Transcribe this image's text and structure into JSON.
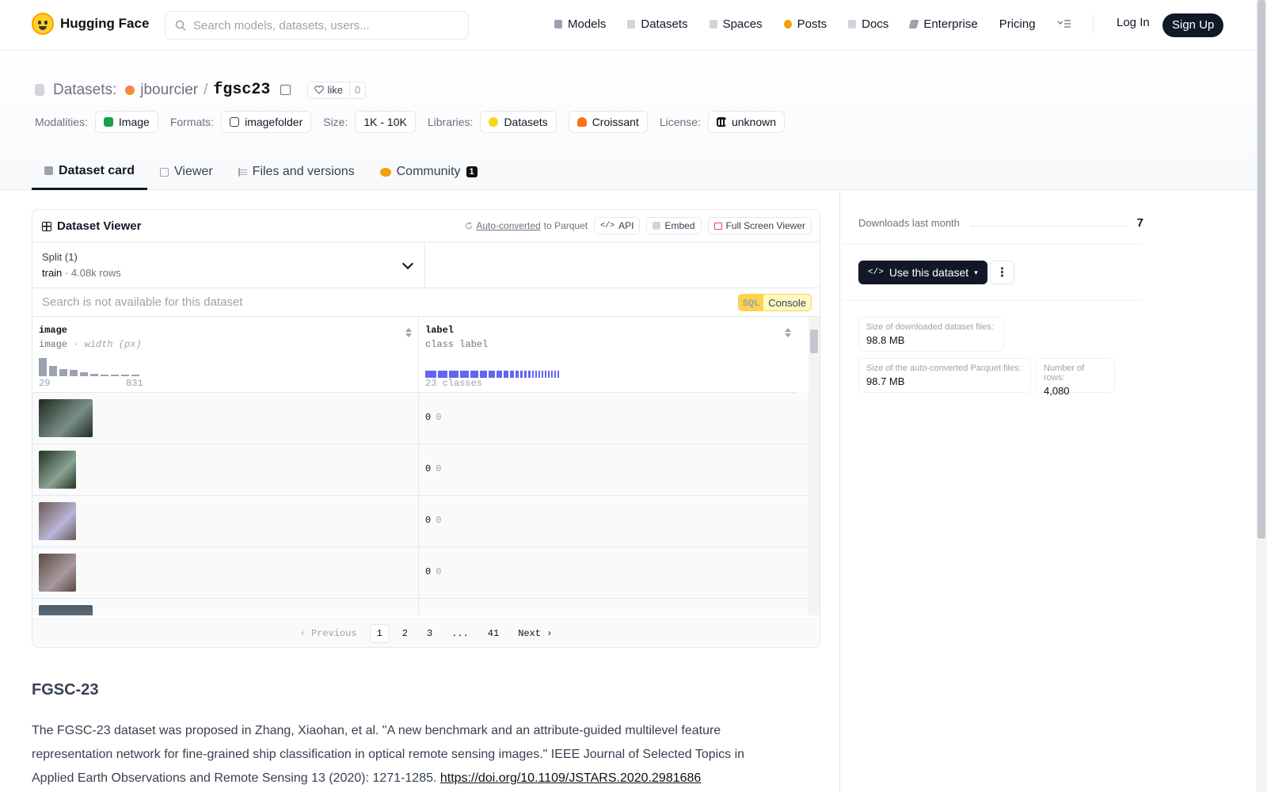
{
  "nav": {
    "brand": "Hugging Face",
    "search_placeholder": "Search models, datasets, users...",
    "links": [
      {
        "label": "Models",
        "icon": "models-icon",
        "color": "#9ca3af"
      },
      {
        "label": "Datasets",
        "icon": "datasets-icon",
        "color": "#d1d5db"
      },
      {
        "label": "Spaces",
        "icon": "spaces-icon",
        "color": "#d1d5db"
      },
      {
        "label": "Posts",
        "icon": "posts-icon",
        "color": "#f59e0b"
      },
      {
        "label": "Docs",
        "icon": "docs-icon",
        "color": "#d1d5db"
      },
      {
        "label": "Enterprise",
        "icon": "enterprise-icon",
        "color": "#9ca3af"
      },
      {
        "label": "Pricing"
      }
    ],
    "login": "Log In",
    "signup": "Sign Up"
  },
  "header": {
    "section": "Datasets:",
    "owner": "jbourcier",
    "separator": "/",
    "repo": "fgsc23",
    "like_label": "like",
    "like_count": "0",
    "tags": [
      {
        "key": "Modalities:",
        "value": "Image",
        "icon": "image-icon",
        "color": "#16a34a"
      },
      {
        "key": "Formats:",
        "value": "imagefolder",
        "icon": "folder-icon",
        "color": "#374151"
      },
      {
        "key": "Size:",
        "value": "1K - 10K"
      },
      {
        "key": "Libraries:",
        "value": "Datasets",
        "icon": "hf-icon",
        "color": "#ffd21e"
      },
      {
        "key": "",
        "value": "Croissant",
        "icon": "croissant-icon",
        "color": "#f97316"
      },
      {
        "key": "License:",
        "value": "unknown",
        "icon": "license-icon",
        "color": "#111827"
      }
    ],
    "tabs": [
      {
        "label": "Dataset card",
        "active": true
      },
      {
        "label": "Viewer"
      },
      {
        "label": "Files and versions"
      },
      {
        "label": "Community",
        "badge": "1"
      }
    ]
  },
  "viewer": {
    "title": "Dataset Viewer",
    "auto_converted": "Auto-converted",
    "to_parquet": "to Parquet",
    "api": "API",
    "embed": "Embed",
    "fullscreen": "Full Screen Viewer",
    "split_label": "Split (1)",
    "split_name": "train",
    "split_rows": "4.08k rows",
    "search_disabled": "Search is not available for this dataset",
    "sql": "SQL",
    "console": "Console",
    "columns": [
      {
        "name": "image",
        "type": "image",
        "subtype": "width (px)",
        "min": "29",
        "max": "831",
        "hist": [
          0.9,
          0.5,
          0.35,
          0.3,
          0.2,
          0.1,
          0.06,
          0.04,
          0.03,
          0.02
        ]
      },
      {
        "name": "label",
        "type": "class label",
        "classes": "23 classes"
      }
    ],
    "rows": [
      {
        "label": "0",
        "label_name": "0",
        "thumb_w": 68,
        "colors": [
          "#1f2a1f",
          "#7a8f8a"
        ]
      },
      {
        "label": "0",
        "label_name": "0",
        "thumb_w": 47,
        "colors": [
          "#233322",
          "#8ba394"
        ]
      },
      {
        "label": "0",
        "label_name": "0",
        "thumb_w": 47,
        "colors": [
          "#6b5b52",
          "#b9b5d8"
        ]
      },
      {
        "label": "0",
        "label_name": "0",
        "thumb_w": 47,
        "colors": [
          "#5a4a44",
          "#a89a9e"
        ]
      }
    ],
    "pages": [
      "1",
      "2",
      "3",
      "...",
      "41"
    ],
    "prev": "Previous",
    "next": "Next"
  },
  "card": {
    "title": "FGSC-23",
    "text": "The FGSC-23 dataset was proposed in Zhang, Xiaohan, et al. \"A new benchmark and an attribute-guided multilevel feature representation network for fine-grained ship classification in optical remote sensing images.\" IEEE Journal of Selected Topics in Applied Earth Observations and Remote Sensing 13 (2020): 1271-1285.",
    "link": "https://doi.org/10.1109/JSTARS.2020.2981686"
  },
  "sidebar": {
    "downloads_label": "Downloads last month",
    "downloads_value": "7",
    "use_button": "Use this dataset",
    "stats": [
      {
        "key": "Size of downloaded dataset files:",
        "value": "98.8 MB"
      },
      {
        "key": "Size of the auto-converted Parquet files:",
        "value": "98.7 MB"
      },
      {
        "key": "Number of rows:",
        "value": "4,080"
      }
    ]
  }
}
